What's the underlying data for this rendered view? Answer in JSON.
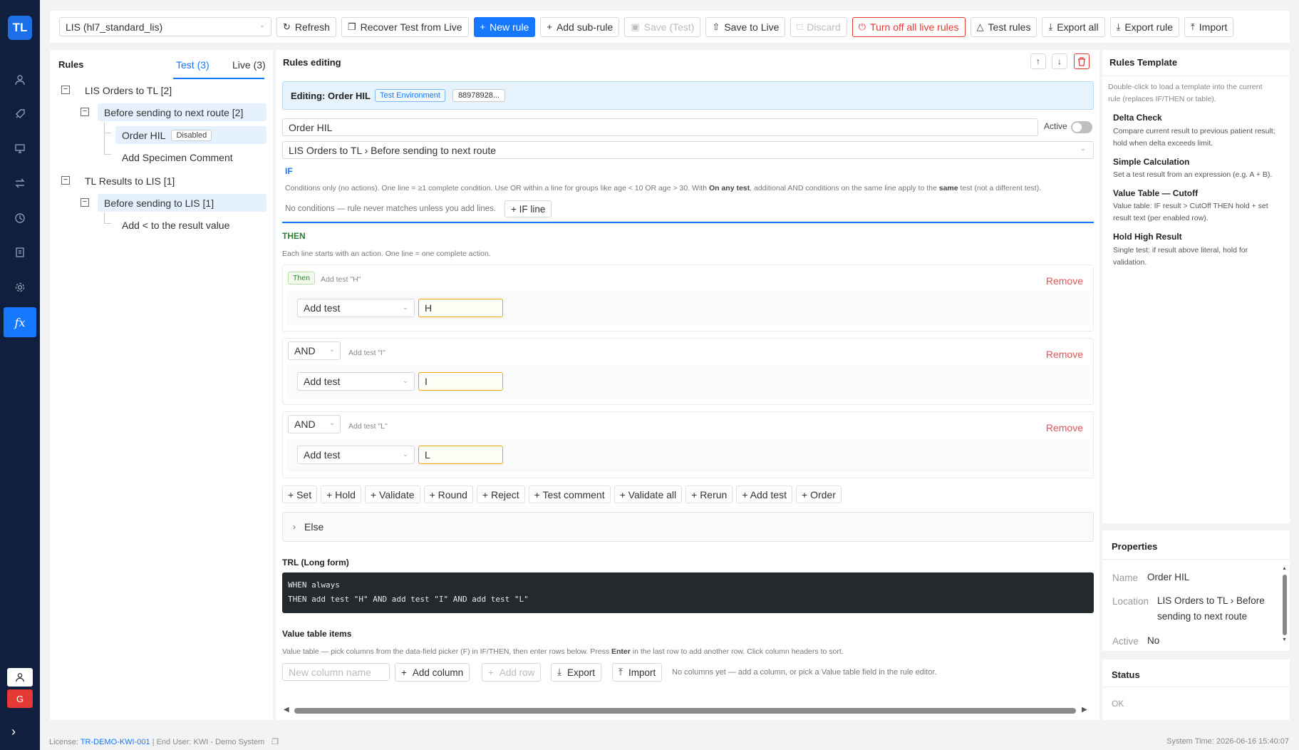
{
  "app": {
    "logo_text": "TL",
    "accent": "#1677ff",
    "sidebar_bg": "#0f1f3d"
  },
  "sidebar": {
    "icons": [
      "user-icon",
      "rocket-icon",
      "monitor-icon",
      "swap-icon",
      "history-icon",
      "report-icon",
      "settings-icon",
      "function-icon"
    ],
    "active_glyph": "fx",
    "user_glyph": "♟",
    "logout_glyph": "G",
    "expand_glyph": "›"
  },
  "toolbar": {
    "profile_select": "LIS (hl7_standard_lis)",
    "refresh": "Refresh",
    "recover": "Recover Test from Live",
    "new_rule": "New rule",
    "add_subrule": "Add sub-rule",
    "save_test": "Save (Test)",
    "save_live": "Save to Live",
    "discard": "Discard",
    "turn_off_live": "Turn off all live rules",
    "test_rules": "Test rules",
    "export_all": "Export all",
    "export_rule": "Export rule",
    "import": "Import"
  },
  "rules_panel": {
    "title": "Rules",
    "tab_test": "Test (3)",
    "tab_live": "Live (3)",
    "tree": [
      {
        "label": "LIS Orders to TL [2]"
      },
      {
        "label": "Before sending to next route [2]"
      },
      {
        "label": "Order HIL",
        "tag": "Disabled"
      },
      {
        "label": "Add Specimen Comment"
      },
      {
        "label": "TL Results to LIS [1]"
      },
      {
        "label": "Before sending to LIS [1]"
      },
      {
        "label": "Add < to the result value"
      }
    ]
  },
  "editor": {
    "title": "Rules editing",
    "banner_title": "Editing: Order HIL",
    "banner_env": "Test Environment",
    "banner_id": "88978928...",
    "name_value": "Order HIL",
    "active_label": "Active",
    "location_value": "LIS Orders to TL › Before sending to next route",
    "if_label": "IF",
    "if_help_1": "Conditions only (no actions). One line = ≥1 complete condition. Use OR within a line for groups like age < 10 OR age > 30. With ",
    "if_help_b1": "On any test",
    "if_help_2": ", additional AND conditions on the same line apply to the ",
    "if_help_b2": "same",
    "if_help_3": " test (not a different test).",
    "if_empty": "No conditions — rule never matches unless you add lines.",
    "if_add": "+ IF line",
    "then_label": "THEN",
    "then_help": "Each line starts with an action. One line = one complete action.",
    "actions": [
      {
        "connector": "Then",
        "hint": "Add test \"H\"",
        "remove": "Remove",
        "action": "Add test",
        "value": "H"
      },
      {
        "connector": "AND",
        "hint": "Add test \"I\"",
        "remove": "Remove",
        "action": "Add test",
        "value": "I"
      },
      {
        "connector": "AND",
        "hint": "Add test \"L\"",
        "remove": "Remove",
        "action": "Add test",
        "value": "L"
      }
    ],
    "quick_actions": [
      "+ Set",
      "+ Hold",
      "+ Validate",
      "+ Round",
      "+ Reject",
      "+ Test comment",
      "+ Validate all",
      "+ Rerun",
      "+ Add test",
      "+ Order"
    ],
    "else_label": "Else",
    "trl_title": "TRL (Long form)",
    "trl_line1": "WHEN always",
    "trl_line2": "THEN add test \"H\" AND add test \"I\" AND add test \"L\"",
    "vt_title": "Value table items",
    "vt_help_1": "Value table — pick columns from the data-field picker (F) in IF/THEN, then enter rows below. Press ",
    "vt_help_b": "Enter",
    "vt_help_2": " in the last row to add another row. Click column headers to sort.",
    "vt_placeholder": "New column name",
    "vt_add_column": "Add column",
    "vt_add_row": "Add row",
    "vt_export": "Export",
    "vt_import": "Import",
    "vt_empty": "No columns yet — add a column, or pick a Value table field in the rule editor."
  },
  "templates": {
    "title": "Rules Template",
    "help": "Double-click to load a template into the current rule (replaces IF/THEN or table).",
    "items": [
      {
        "title": "Delta Check",
        "desc": "Compare current result to previous patient result; hold when delta exceeds limit."
      },
      {
        "title": "Simple Calculation",
        "desc": "Set a test result from an expression (e.g. A + B)."
      },
      {
        "title": "Value Table — Cutoff",
        "desc": "Value table: IF result > CutOff THEN hold + set result text (per enabled row)."
      },
      {
        "title": "Hold High Result",
        "desc": "Single test: if result above literal, hold for validation."
      }
    ]
  },
  "properties": {
    "title": "Properties",
    "name_key": "Name",
    "name_val": "Order HIL",
    "loc_key": "Location",
    "loc_val": "LIS Orders to TL › Before sending to next route",
    "active_key": "Active",
    "active_val": "No"
  },
  "status": {
    "title": "Status",
    "value": "OK"
  },
  "footer": {
    "license_label": "License: ",
    "license_id": "TR-DEMO-KWI-001",
    "end_user": " | End User: KWI - Demo System",
    "system_time": "System Time: 2026-06-16 15:40:07"
  }
}
